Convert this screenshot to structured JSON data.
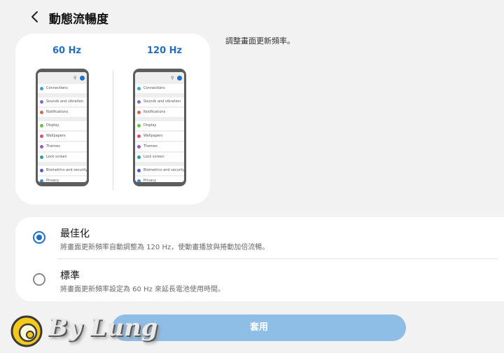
{
  "header": {
    "title": "動態流暢度"
  },
  "preview": {
    "left_label": "60 Hz",
    "right_label": "120 Hz",
    "menu_items": [
      "Connections",
      "Sounds and vibration",
      "Notifications",
      "Display",
      "Wallpapers",
      "Themes",
      "Lock screen",
      "Biometrics and security",
      "Privacy"
    ],
    "menu_colors": [
      "#3aa0e0",
      "#7a6ad8",
      "#e0604a",
      "#6cc04a",
      "#e24e6a",
      "#9b59d0",
      "#2aa38a",
      "#4a5ad8",
      "#3a8ae0"
    ]
  },
  "description": "調整畫面更新頻率。",
  "options": [
    {
      "title": "最佳化",
      "subtitle": "將畫面更新頻率自動調整為 120 Hz，使動畫播放與捲動加倍流暢。",
      "selected": true
    },
    {
      "title": "標準",
      "subtitle": "將畫面更新頻率設定為 60 Hz 來延長電池使用時間。",
      "selected": false
    }
  ],
  "apply_label": "套用",
  "watermark": {
    "text": "By Lung"
  },
  "colors": {
    "accent": "#1f6fc7",
    "button": "#8ebde6",
    "background": "#f2f2f2"
  }
}
